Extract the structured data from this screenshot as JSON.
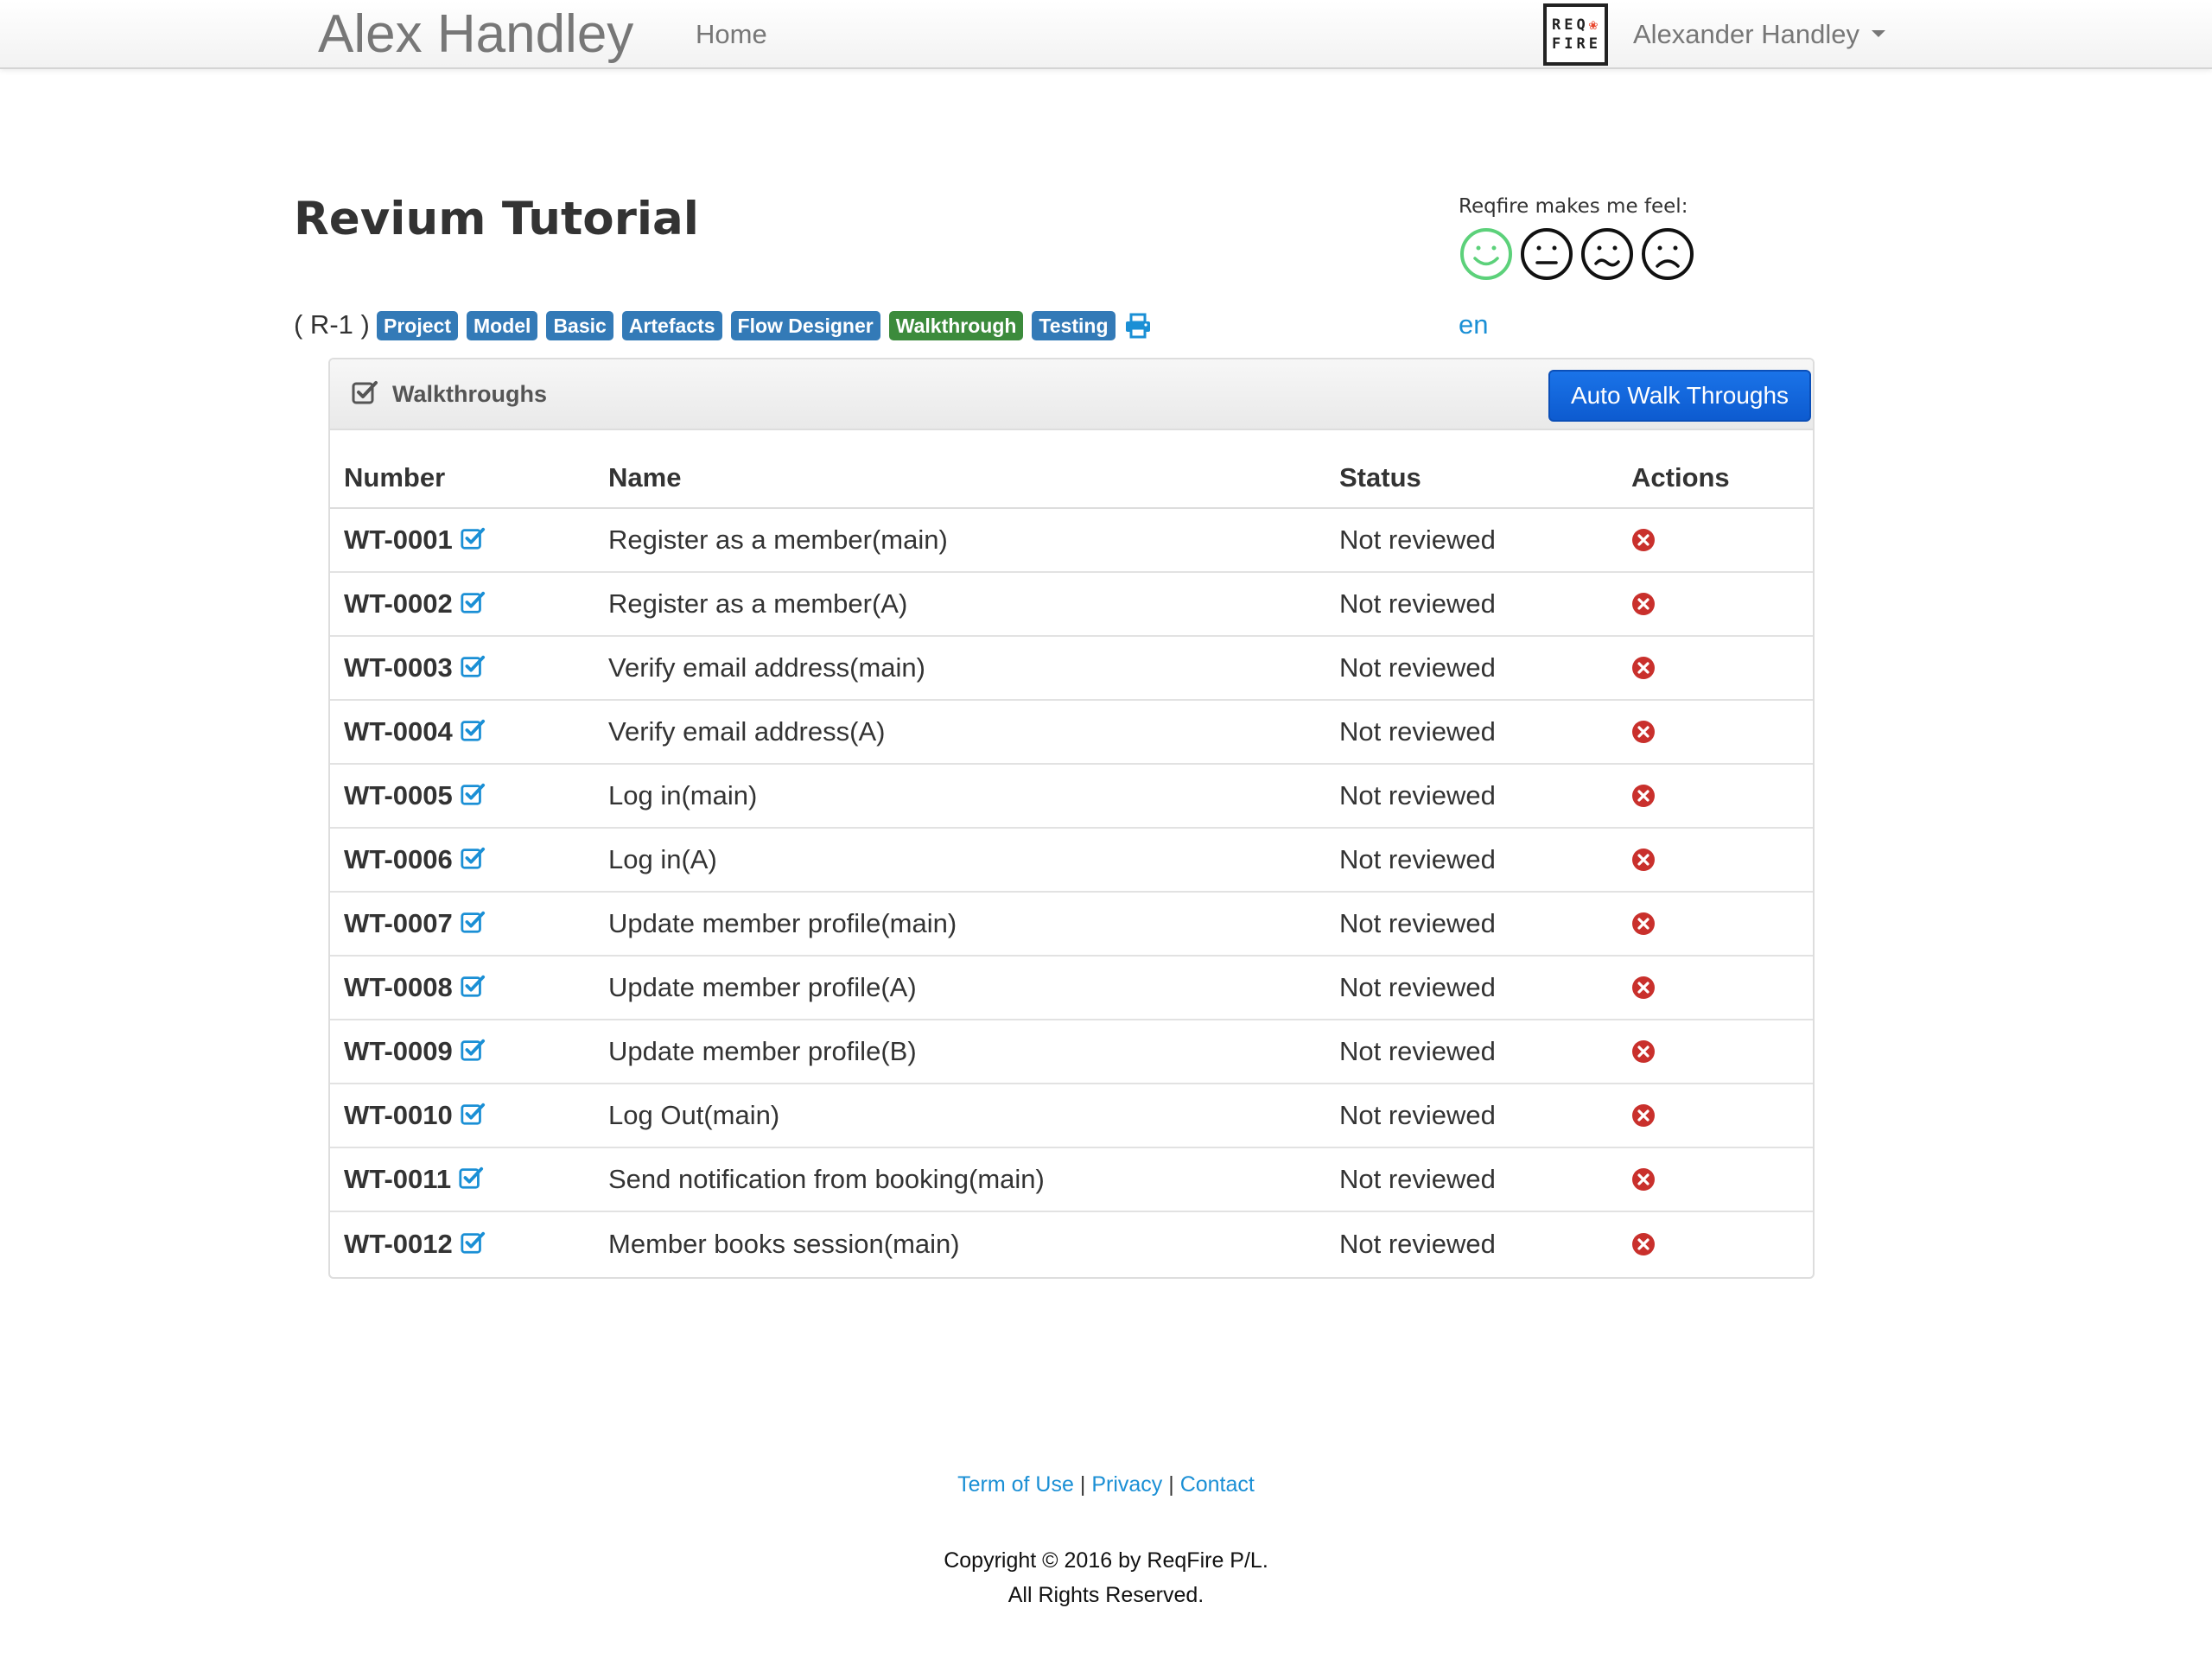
{
  "navbar": {
    "brand": "Alex Handley",
    "home": "Home",
    "logo_line1": "REQ",
    "logo_line2": "FIRE",
    "user": "Alexander Handley"
  },
  "header": {
    "title": "Revium Tutorial",
    "feel_label": "Reqfire makes me feel:",
    "faces": [
      "happy-face-icon",
      "neutral-face-icon",
      "worried-face-icon",
      "sad-face-icon"
    ],
    "project_id": "( R-1 )",
    "tags": [
      {
        "label": "Project",
        "active": false
      },
      {
        "label": "Model",
        "active": false
      },
      {
        "label": "Basic",
        "active": false
      },
      {
        "label": "Artefacts",
        "active": false
      },
      {
        "label": "Flow Designer",
        "active": false
      },
      {
        "label": "Walkthrough",
        "active": true
      },
      {
        "label": "Testing",
        "active": false
      }
    ],
    "lang": "en"
  },
  "panel": {
    "title": "Walkthroughs",
    "auto_button": "Auto Walk Throughs",
    "columns": [
      "Number",
      "Name",
      "Status",
      "Actions"
    ],
    "rows": [
      {
        "number": "WT-0001",
        "name": "Register as a member(main)",
        "status": "Not reviewed"
      },
      {
        "number": "WT-0002",
        "name": "Register as a member(A)",
        "status": "Not reviewed"
      },
      {
        "number": "WT-0003",
        "name": "Verify email address(main)",
        "status": "Not reviewed"
      },
      {
        "number": "WT-0004",
        "name": "Verify email address(A)",
        "status": "Not reviewed"
      },
      {
        "number": "WT-0005",
        "name": "Log in(main)",
        "status": "Not reviewed"
      },
      {
        "number": "WT-0006",
        "name": "Log in(A)",
        "status": "Not reviewed"
      },
      {
        "number": "WT-0007",
        "name": "Update member profile(main)",
        "status": "Not reviewed"
      },
      {
        "number": "WT-0008",
        "name": "Update member profile(A)",
        "status": "Not reviewed"
      },
      {
        "number": "WT-0009",
        "name": "Update member profile(B)",
        "status": "Not reviewed"
      },
      {
        "number": "WT-0010",
        "name": "Log Out(main)",
        "status": "Not reviewed"
      },
      {
        "number": "WT-0011",
        "name": "Send notification from booking(main)",
        "status": "Not reviewed"
      },
      {
        "number": "WT-0012",
        "name": "Member books session(main)",
        "status": "Not reviewed"
      }
    ]
  },
  "footer": {
    "links": [
      "Term of Use",
      "Privacy",
      "Contact"
    ],
    "separator": "|",
    "copyright_line1": "Copyright © 2016 by ReqFire P/L.",
    "copyright_line2": "All Rights Reserved."
  },
  "colors": {
    "tag": "#337ab7",
    "tag_active": "#3c8b3c",
    "link": "#1a8fd5",
    "button": "#1a73e8",
    "delete": "#c9302c",
    "happy_face": "#5cd17a"
  }
}
